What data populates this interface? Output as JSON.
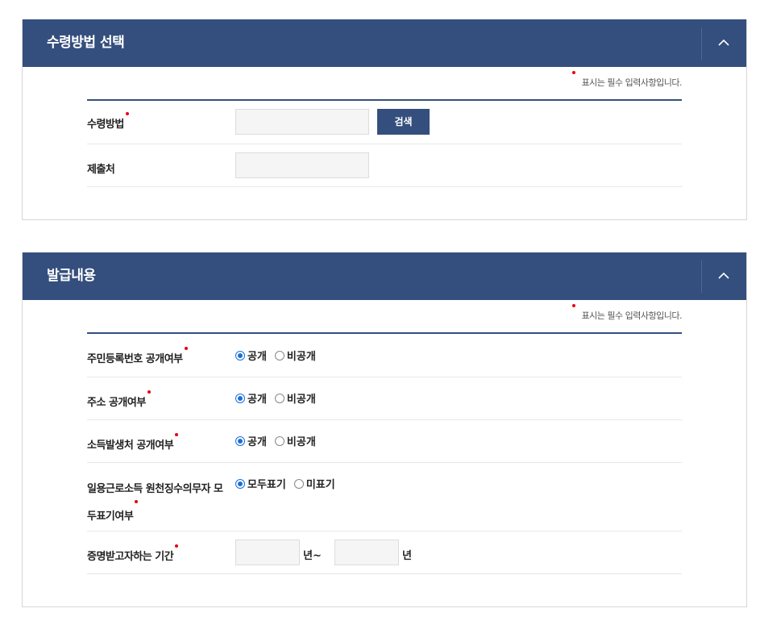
{
  "receipt": {
    "title": "수령방법 선택",
    "required_note": "표시는 필수 입력사항입니다.",
    "method_label": "수령방법",
    "search_label": "검색",
    "submit_to_label": "제출처"
  },
  "issuance": {
    "title": "발급내용",
    "required_note": "표시는 필수 입력사항입니다.",
    "rows": [
      {
        "label": "주민등록번호 공개여부",
        "opt1": "공개",
        "opt2": "비공개"
      },
      {
        "label": "주소 공개여부",
        "opt1": "공개",
        "opt2": "비공개"
      },
      {
        "label": "소득발생처 공개여부",
        "opt1": "공개",
        "opt2": "비공개"
      },
      {
        "label_line1": "일용근로소득 원천징수의무자 모",
        "label_line2": "두표기여부",
        "opt1": "모두표기",
        "opt2": "미표기"
      }
    ],
    "period_label": "증명받고자하는 기간",
    "year_unit_1": "년~",
    "year_unit_2": "년"
  },
  "colors": {
    "header": "#344f7d",
    "required_dot": "#e60012",
    "radio": "#1a6fd8"
  }
}
